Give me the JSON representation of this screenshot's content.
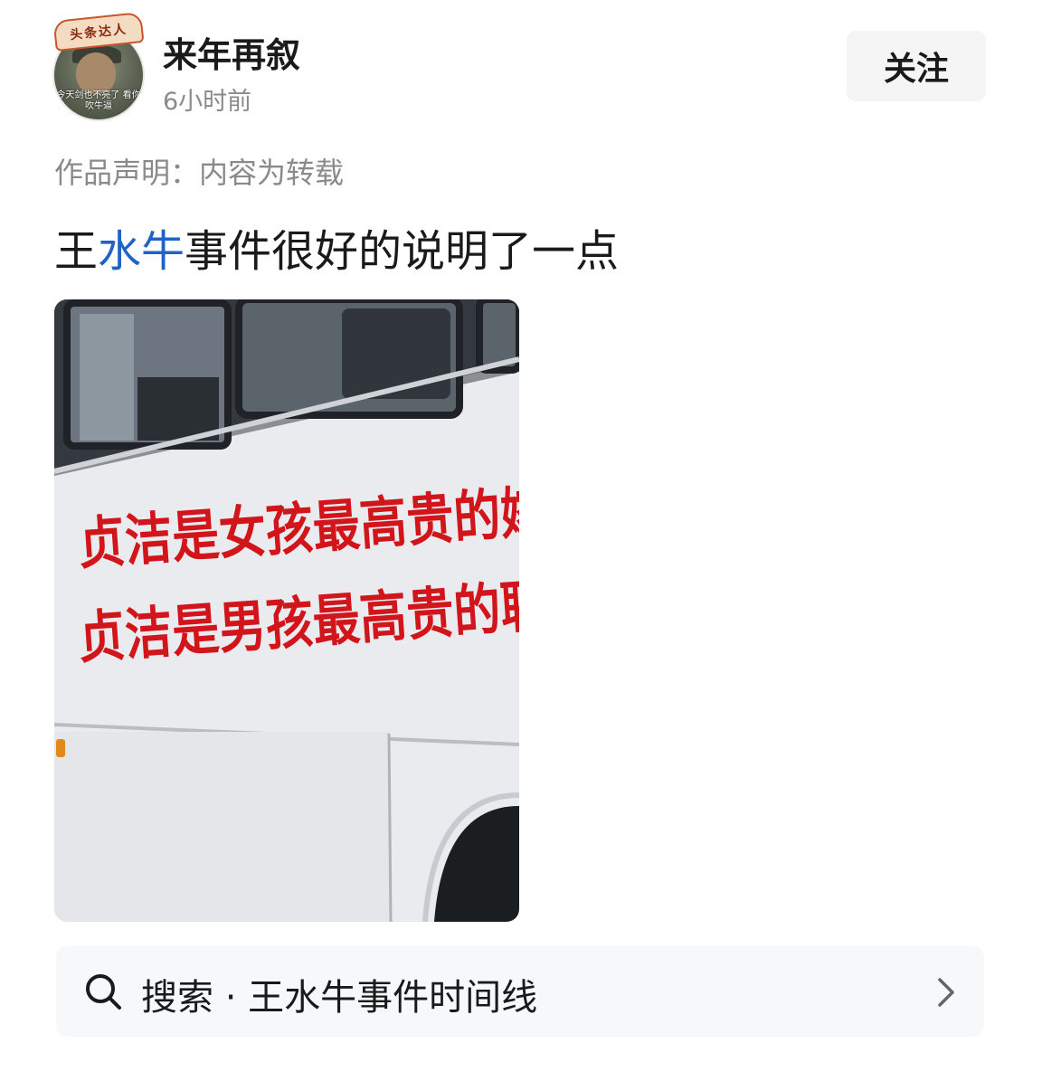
{
  "author": {
    "name": "来年再叙",
    "time": "6小时前",
    "badge": "头条达人",
    "avatar_caption": "今天剑也不亮了 看你吹牛逼"
  },
  "follow_label": "关注",
  "declaration": "作品声明：内容为转载",
  "post": {
    "title_pre": "王",
    "title_link": "水牛",
    "title_post": "事件很好的说明了一点"
  },
  "image": {
    "line1": "贞洁是女孩最高贵的嫁",
    "line2": "贞洁是男孩最高贵的聘"
  },
  "search": {
    "text": "搜索 · 王水牛事件时间线",
    "icon": "search-icon",
    "chevron": "chevron-right-icon"
  },
  "colors": {
    "link": "#1f63c6",
    "slogan": "#d2141b"
  }
}
